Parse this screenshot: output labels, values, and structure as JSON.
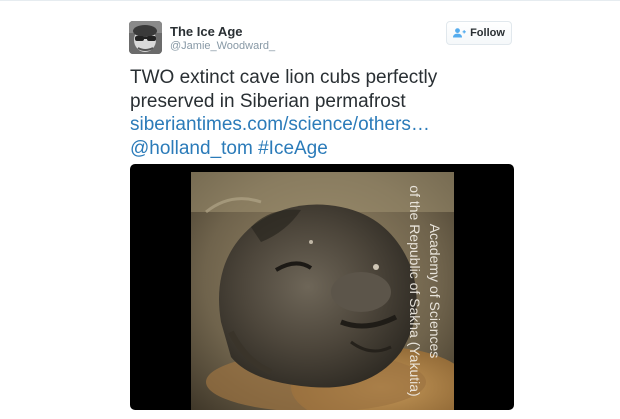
{
  "tweet": {
    "author": {
      "name": "The Ice Age",
      "handle": "@Jamie_Woodward_",
      "avatar_icon": "avatar-icon"
    },
    "follow_button": {
      "label": "Follow",
      "icon": "add-user-icon"
    },
    "text": {
      "line1": "TWO extinct cave lion cubs perfectly",
      "line2": "preserved in Siberian permafrost",
      "link": "siberiantimes.com/science/others…",
      "mention": "@holland_tom",
      "hashtag": "#IceAge"
    },
    "media": {
      "watermark_line1": "Academy of Sciences",
      "watermark_line2": "of the Republic of Sakha (Yakutia)"
    }
  },
  "colors": {
    "link": "#2b7bb9",
    "text": "#292f33",
    "muted": "#8899a6",
    "media_background": "#000000"
  }
}
